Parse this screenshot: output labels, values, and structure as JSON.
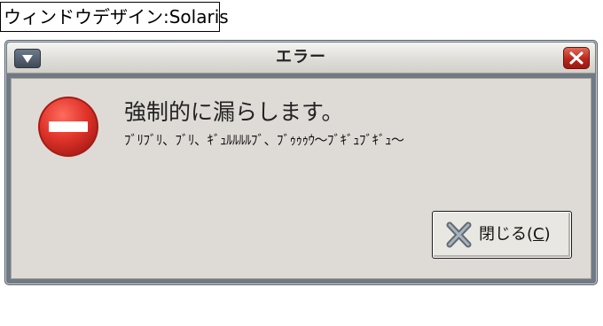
{
  "caption": "ウィンドウデザイン:Solaris",
  "window": {
    "title": "エラー",
    "menu_icon": "window-menu-icon",
    "close_icon": "close-x-icon"
  },
  "dialog": {
    "icon": "stop-icon",
    "message": "強制的に漏らします。",
    "detail": "ﾌﾞﾘﾌﾞﾘ、ﾌﾞﾘ、ｷﾞｭﾙﾙﾙﾙﾌﾞ、ﾌﾞｩｩｩｳ〜ﾌﾞｷﾞｭﾌﾞｷﾞｭ〜",
    "close_button": {
      "label": "閉じる(",
      "mnemonic": "C",
      "label_end": ")",
      "icon": "close-x-icon"
    }
  },
  "colors": {
    "title_bar": "#dedcd6",
    "close_button": "#b8271c",
    "stop_icon": "#e53935",
    "content_bg": "#dedbd6"
  }
}
